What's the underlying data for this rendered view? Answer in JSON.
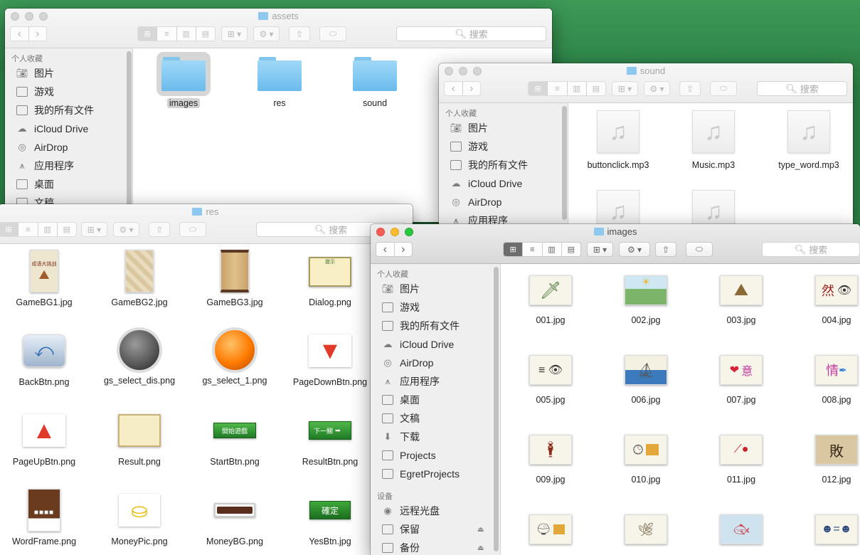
{
  "desktop": {
    "color": "#2f8a4a"
  },
  "sidebar_common": {
    "favorites_header": "个人收藏",
    "items": [
      {
        "label": "图片",
        "icon": "camera-icon"
      },
      {
        "label": "游戏",
        "icon": "folder-icon"
      },
      {
        "label": "我的所有文件",
        "icon": "all-files-icon"
      },
      {
        "label": "iCloud Drive",
        "icon": "cloud-icon"
      },
      {
        "label": "AirDrop",
        "icon": "airdrop-icon"
      },
      {
        "label": "应用程序",
        "icon": "applications-icon"
      },
      {
        "label": "桌面",
        "icon": "desktop-icon"
      },
      {
        "label": "文稿",
        "icon": "documents-icon"
      },
      {
        "label": "下载",
        "icon": "download-icon"
      },
      {
        "label": "Projects",
        "icon": "folder-icon"
      },
      {
        "label": "EgretProjects",
        "icon": "folder-icon"
      }
    ],
    "devices_header": "设备",
    "devices": [
      {
        "label": "远程光盘",
        "icon": "disc-icon"
      },
      {
        "label": "保留",
        "icon": "drive-icon"
      },
      {
        "label": "备份",
        "icon": "drive-icon"
      }
    ]
  },
  "toolbar": {
    "back": "‹",
    "forward": "›",
    "search_placeholder": "搜索",
    "view_icons": [
      "⊞",
      "≡",
      "▥",
      "▤"
    ],
    "arrange": "⊞ ▾",
    "action": "⚙ ▾",
    "share": "⇧",
    "tag": "⬭"
  },
  "assets_window": {
    "title": "assets",
    "folders": [
      {
        "name": "images"
      },
      {
        "name": "res"
      },
      {
        "name": "sound"
      }
    ]
  },
  "sound_window": {
    "title": "sound",
    "files": [
      {
        "name": "buttonclick.mp3"
      },
      {
        "name": "Music.mp3"
      },
      {
        "name": "type_word.mp3"
      },
      {
        "name": ""
      },
      {
        "name": ""
      }
    ]
  },
  "res_window": {
    "title": "res",
    "files": [
      {
        "name": "GameBG1.jpg"
      },
      {
        "name": "GameBG2.jpg"
      },
      {
        "name": "GameBG3.jpg"
      },
      {
        "name": "Dialog.png"
      },
      {
        "name": "BackBtn.png"
      },
      {
        "name": "gs_select_dis.png"
      },
      {
        "name": "gs_select_1.png"
      },
      {
        "name": "PageDownBtn.png"
      },
      {
        "name": "PageUpBtn.png"
      },
      {
        "name": "Result.png"
      },
      {
        "name": "StartBtn.png"
      },
      {
        "name": "ResultBtn.png"
      },
      {
        "name": "WordFrame.png"
      },
      {
        "name": "MoneyPic.png"
      },
      {
        "name": "MoneyBG.png"
      },
      {
        "name": "YesBtn.jpg"
      }
    ],
    "thumb_text": {
      "game_bg1": "成语大挑战",
      "dialog": "提示",
      "start": "開始遊戲",
      "result_btn": "下一關",
      "yes": "確定"
    }
  },
  "images_window": {
    "title": "images",
    "files": [
      {
        "name": "001.jpg"
      },
      {
        "name": "002.jpg"
      },
      {
        "name": "003.jpg"
      },
      {
        "name": "004.jpg"
      },
      {
        "name": "005.jpg"
      },
      {
        "name": "006.jpg"
      },
      {
        "name": "007.jpg"
      },
      {
        "name": "008.jpg"
      },
      {
        "name": "009.jpg"
      },
      {
        "name": "010.jpg"
      },
      {
        "name": "011.jpg"
      },
      {
        "name": "012.jpg"
      },
      {
        "name": ""
      },
      {
        "name": ""
      },
      {
        "name": ""
      },
      {
        "name": ""
      }
    ],
    "thumb_text": {
      "t004": "然",
      "t007": "意",
      "t008": "情",
      "t012": "敗"
    }
  }
}
